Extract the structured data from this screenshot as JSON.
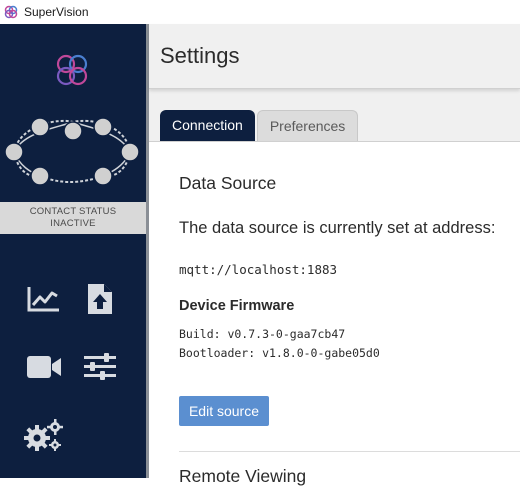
{
  "window": {
    "title": "SuperVision"
  },
  "sidebar": {
    "contact_status": {
      "line1": "CONTACT STATUS",
      "line2": "INACTIVE"
    },
    "nav": [
      {
        "icon": "chart-icon"
      },
      {
        "icon": "upload-file-icon"
      },
      {
        "icon": "video-camera-icon"
      },
      {
        "icon": "sliders-icon"
      },
      {
        "icon": "gears-icon"
      }
    ]
  },
  "header": {
    "title": "Settings"
  },
  "tabs": [
    {
      "label": "Connection",
      "active": true
    },
    {
      "label": "Preferences",
      "active": false
    }
  ],
  "connection": {
    "data_source_title": "Data Source",
    "description": "The data source is currently set at address:",
    "address": "mqtt://localhost:1883",
    "firmware_title": "Device Firmware",
    "build": "Build: v0.7.3-0-gaa7cb47",
    "bootloader": "Bootloader: v1.8.0-0-gabe05d0",
    "edit_button": "Edit source",
    "next_section_title": "Remote Viewing"
  },
  "colors": {
    "sidebar": "#0d1f3f",
    "accent_button": "#5b8fd0",
    "active_tab": "#0d1f3f"
  }
}
